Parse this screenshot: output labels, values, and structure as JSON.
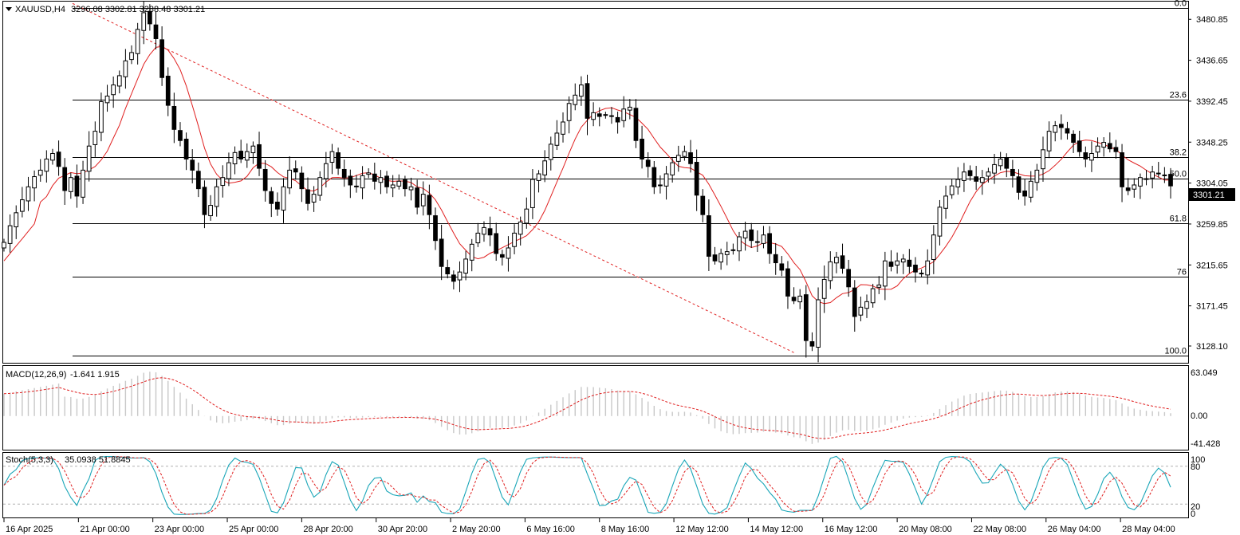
{
  "header": {
    "symbol_tf": "XAUUSD,H4",
    "ohlc": "3296.08 3302.81 3288.48 3301.21"
  },
  "chart_data": [
    {
      "type": "candlestick",
      "price_axis": {
        "range": [
          3110,
          3500
        ],
        "ticks": [
          3480.85,
          3436.65,
          3392.45,
          3348.25,
          3304.05,
          3259.85,
          3215.65,
          3171.45,
          3128.1
        ],
        "tick_labels": [
          "3480.85",
          "3436.65",
          "3392.45",
          "3348.25",
          "3304.05",
          "3259.85",
          "3215.65",
          "3171.45",
          "3128.10"
        ]
      },
      "current_price": "3301.21",
      "fibonacci": [
        {
          "label": "0.0",
          "price": 3493
        },
        {
          "label": "23.6",
          "price": 3394
        },
        {
          "label": "38.2",
          "price": 3332.5
        },
        {
          "label": "50.0",
          "price": 3309
        },
        {
          "label": "61.8",
          "price": 3261
        },
        {
          "label": "76",
          "price": 3203
        },
        {
          "label": "100.0",
          "price": 3118
        }
      ],
      "trendline": {
        "from": [
          "21 Apr 2025",
          3498
        ],
        "to": [
          "14 May 2025",
          3120
        ]
      },
      "time_labels": [
        "16 Apr 2025",
        "21 Apr 00:00",
        "23 Apr 00:00",
        "25 Apr 00:00",
        "28 Apr 20:00",
        "30 Apr 20:00",
        "2 May 20:00",
        "6 May 16:00",
        "8 May 16:00",
        "12 May 12:00",
        "14 May 12:00",
        "16 May 12:00",
        "20 May 08:00",
        "22 May 08:00",
        "26 May 04:00",
        "28 May 04:00"
      ],
      "close": [
        3240,
        3258,
        3272,
        3286,
        3300,
        3311,
        3318,
        3330,
        3336,
        3322,
        3296,
        3310,
        3290,
        3318,
        3344,
        3360,
        3392,
        3398,
        3410,
        3420,
        3436,
        3445,
        3470,
        3488,
        3476,
        3460,
        3418,
        3388,
        3362,
        3350,
        3330,
        3318,
        3298,
        3270,
        3280,
        3300,
        3310,
        3326,
        3337,
        3330,
        3338,
        3344,
        3320,
        3296,
        3282,
        3276,
        3300,
        3318,
        3316,
        3298,
        3282,
        3292,
        3310,
        3325,
        3338,
        3320,
        3310,
        3302,
        3300,
        3312,
        3315,
        3306,
        3310,
        3300,
        3302,
        3306,
        3298,
        3300,
        3278,
        3292,
        3270,
        3242,
        3214,
        3206,
        3198,
        3208,
        3222,
        3238,
        3250,
        3256,
        3248,
        3228,
        3224,
        3234,
        3250,
        3262,
        3276,
        3308,
        3314,
        3328,
        3346,
        3358,
        3370,
        3390,
        3399,
        3410,
        3374,
        3380,
        3376,
        3378,
        3376,
        3370,
        3384,
        3386,
        3350,
        3330,
        3322,
        3300,
        3302,
        3314,
        3326,
        3334,
        3338,
        3325,
        3291,
        3270,
        3225,
        3220,
        3228,
        3230,
        3232,
        3246,
        3252,
        3242,
        3240,
        3248,
        3228,
        3218,
        3210,
        3182,
        3177,
        3182,
        3134,
        3128,
        3178,
        3200,
        3219,
        3224,
        3212,
        3192,
        3160,
        3170,
        3176,
        3190,
        3194,
        3220,
        3214,
        3220,
        3222,
        3214,
        3208,
        3206,
        3220,
        3248,
        3278,
        3290,
        3301,
        3308,
        3316,
        3312,
        3306,
        3310,
        3316,
        3324,
        3330,
        3320,
        3312,
        3294,
        3290,
        3306,
        3318,
        3340,
        3360,
        3366,
        3364,
        3358,
        3348,
        3338,
        3330,
        3336,
        3344,
        3348,
        3341,
        3338,
        3300,
        3296,
        3302,
        3310,
        3308,
        3316,
        3314,
        3312,
        3301
      ]
    },
    {
      "type": "histogram",
      "name": "MACD(12,26,9)",
      "values_label": "-1.641 1.915",
      "axis_labels": [
        "63.049",
        "0.00",
        "-41.428"
      ],
      "range": [
        -44,
        66
      ]
    },
    {
      "type": "line",
      "name": "Stoch(5,3,3)",
      "values_label": "35.0938 51.8845",
      "axis_labels": [
        "100",
        "80",
        "20",
        "0"
      ],
      "range": [
        0,
        100
      ]
    }
  ],
  "colors": {
    "ma": "#e02020",
    "signal": "#e02020",
    "stoch_main": "#1aa6b8",
    "macd_hist": "#c8c8c8",
    "fib": "#000000",
    "trend": "#e02020"
  }
}
